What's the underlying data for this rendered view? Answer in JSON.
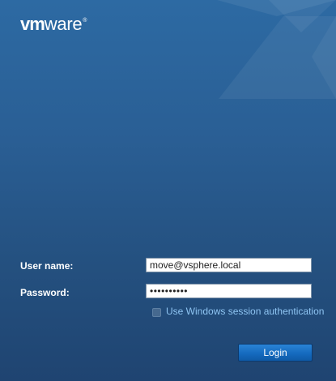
{
  "brand": {
    "logo_bold": "vm",
    "logo_rest": "ware",
    "logo_mark": "®"
  },
  "form": {
    "username_label": "User name:",
    "username_value": "move@vsphere.local",
    "password_label": "Password:",
    "password_value": "••••••••••",
    "windows_auth_label": "Use Windows session authentication",
    "windows_auth_checked": false,
    "login_label": "Login"
  },
  "colors": {
    "background_top": "#2d6aa3",
    "background_bottom": "#1f4471",
    "link_text": "#8ec4f2",
    "button": "#156bbf"
  }
}
